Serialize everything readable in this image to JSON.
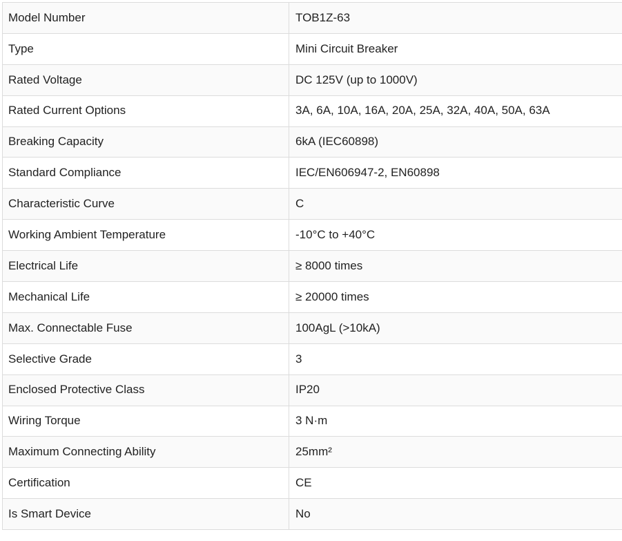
{
  "specs": {
    "rows": [
      {
        "label": "Model Number",
        "value": "TOB1Z-63"
      },
      {
        "label": "Type",
        "value": "Mini Circuit Breaker"
      },
      {
        "label": "Rated Voltage",
        "value": "DC 125V (up to 1000V)"
      },
      {
        "label": "Rated Current Options",
        "value": "3A, 6A, 10A, 16A, 20A, 25A, 32A, 40A, 50A, 63A"
      },
      {
        "label": "Breaking Capacity",
        "value": "6kA (IEC60898)"
      },
      {
        "label": "Standard Compliance",
        "value": "IEC/EN606947-2, EN60898"
      },
      {
        "label": "Characteristic Curve",
        "value": "C"
      },
      {
        "label": "Working Ambient Temperature",
        "value": "-10°C to +40°C"
      },
      {
        "label": "Electrical Life",
        "value": "≥ 8000 times"
      },
      {
        "label": "Mechanical Life",
        "value": "≥ 20000 times"
      },
      {
        "label": "Max. Connectable Fuse",
        "value": "100AgL (>10kA)"
      },
      {
        "label": "Selective Grade",
        "value": "3"
      },
      {
        "label": "Enclosed Protective Class",
        "value": "IP20"
      },
      {
        "label": "Wiring Torque",
        "value": "3 N·m"
      },
      {
        "label": "Maximum Connecting Ability",
        "value": "25mm²"
      },
      {
        "label": "Certification",
        "value": "CE"
      },
      {
        "label": "Is Smart Device",
        "value": "No"
      }
    ]
  }
}
